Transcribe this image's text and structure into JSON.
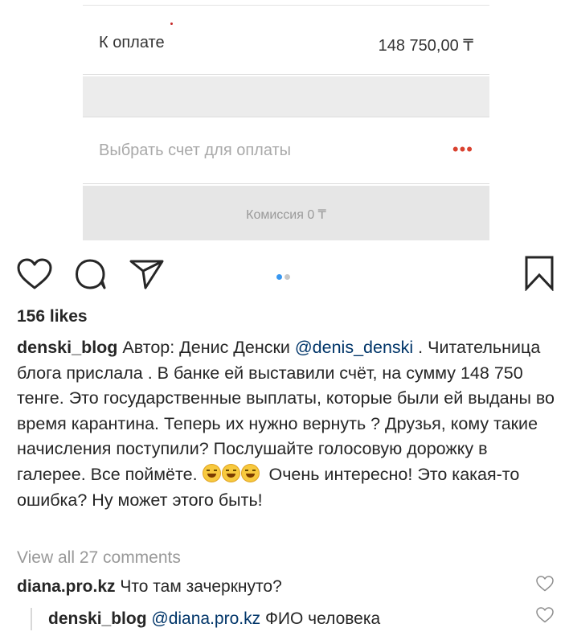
{
  "payment": {
    "label": "К оплате",
    "amount": "148 750,00 ₸",
    "account_placeholder": "Выбрать счет для оплаты",
    "more_glyph": "•••",
    "commission": "Комиссия 0 ₸"
  },
  "carousel": {
    "active_index": 0,
    "count": 2
  },
  "likes": "156 likes",
  "caption": {
    "username": "denski_blog",
    "text_1": " Автор: Денис Денски ",
    "mention": "@denis_denski",
    "text_2": " . Читательница блога прислала . В банке ей выставили счёт,  на сумму 148 750 тенге. Это государственные выплаты,  которые были ей выданы во время карантина. Теперь их нужно вернуть ? Друзья, кому такие начисления поступили? Послушайте голосовую дорожку в галерее. Все поймёте. ",
    "emoji": "😆😆😆",
    "text_3": " Очень интересно! Это какая-то ошибка? Ну может этого быть!"
  },
  "view_all_comments": "View all 27 comments",
  "comments": [
    {
      "username": "diana.pro.kz",
      "text": " Что там зачеркнуто?"
    },
    {
      "username": "denski_blog",
      "mention": "@diana.pro.kz",
      "text": " ФИО человека"
    }
  ],
  "colors": {
    "accent_blue": "#3897f0",
    "mention_blue": "#003569",
    "more_red": "#d9412f"
  }
}
